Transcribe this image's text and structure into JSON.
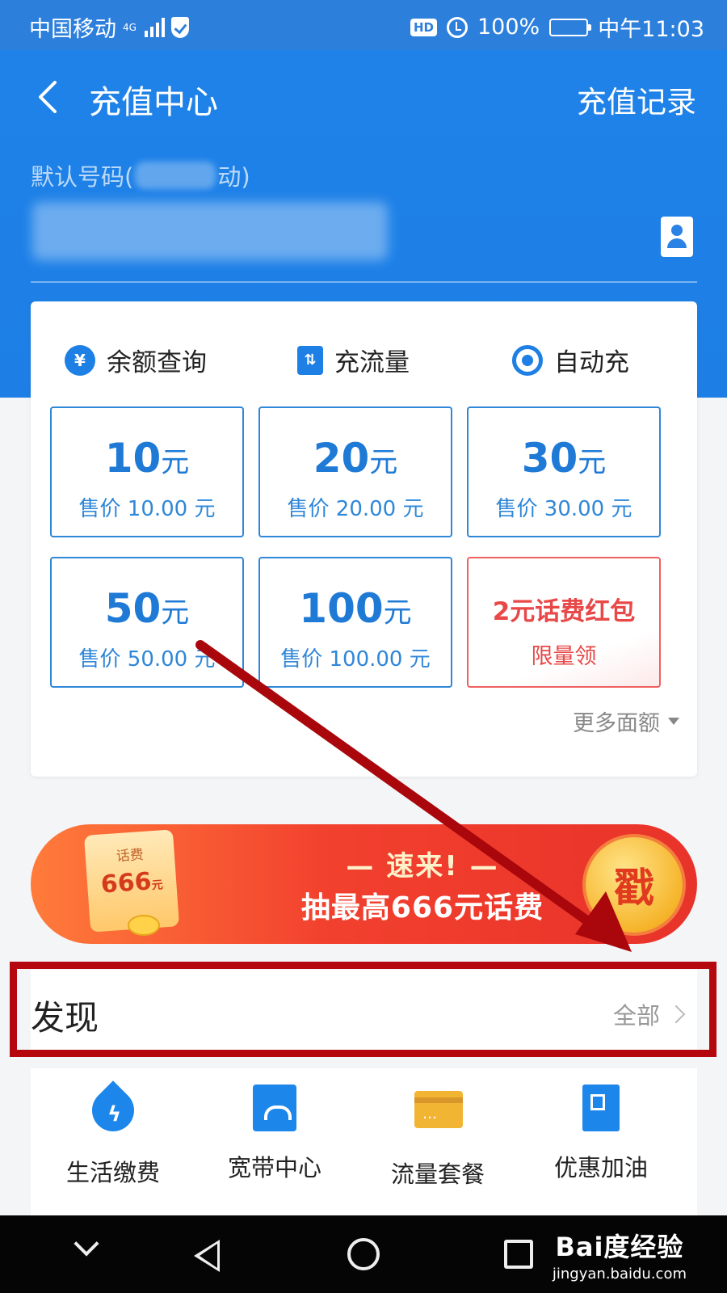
{
  "status_bar": {
    "carrier": "中国移动",
    "network": "4G",
    "hd": "HD",
    "battery": "100%",
    "battery_level": 1.0,
    "time": "中午11:03"
  },
  "header": {
    "title": "充值中心",
    "history_link": "充值记录",
    "default_number_label_start": "默认号码(",
    "default_number_label_end": "动)",
    "back_icon": "chevron-left-icon",
    "contact_icon": "contact-book-icon"
  },
  "quick_actions": [
    {
      "label": "余额查询",
      "icon": "yuan-search-icon",
      "glyph": "¥"
    },
    {
      "label": "充流量",
      "icon": "data-transfer-icon",
      "glyph": "⇅"
    },
    {
      "label": "自动充",
      "icon": "auto-refresh-icon",
      "glyph": ""
    }
  ],
  "amounts": [
    {
      "value": "10",
      "unit": "元",
      "price": "售价 10.00 元"
    },
    {
      "value": "20",
      "unit": "元",
      "price": "售价 20.00 元"
    },
    {
      "value": "30",
      "unit": "元",
      "price": "售价 30.00 元"
    },
    {
      "value": "50",
      "unit": "元",
      "price": "售价 50.00 元"
    },
    {
      "value": "100",
      "unit": "元",
      "price": "售价 100.00 元"
    }
  ],
  "promo_tile": {
    "title": "2元话费红包",
    "subtitle": "限量领"
  },
  "more_amounts": "更多面额",
  "banner": {
    "coupon_label": "话费",
    "coupon_amount": "666",
    "coupon_unit": "元",
    "line1": "— 速来! —",
    "line2": "抽最高666元话费",
    "button": "戳"
  },
  "discover": {
    "title": "发现",
    "all_link": "全部"
  },
  "services": [
    {
      "label": "生活缴费",
      "icon": "utility-drop-icon"
    },
    {
      "label": "宽带中心",
      "icon": "broadband-router-icon"
    },
    {
      "label": "流量套餐",
      "icon": "data-card-icon"
    },
    {
      "label": "优惠加油",
      "icon": "fuel-pump-icon"
    }
  ],
  "watermark": {
    "main": "Bai度经验",
    "sub": "jingyan.baidu.com"
  },
  "colors": {
    "primary_blue": "#1f82e8",
    "tile_blue": "#2f87d8",
    "promo_red": "#e84848",
    "annotation_red": "#b4080e",
    "banner_orange": "#f2402e"
  }
}
